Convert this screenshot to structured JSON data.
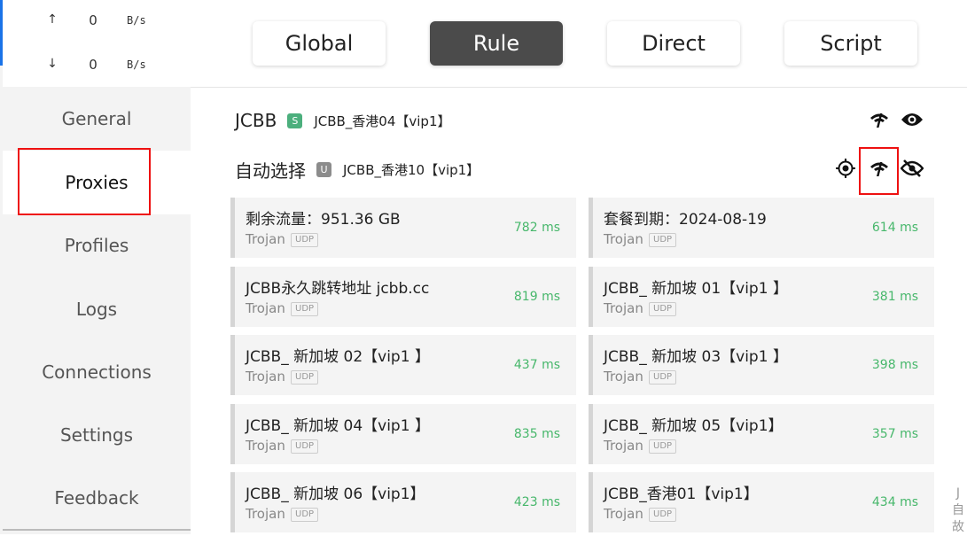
{
  "traffic": {
    "upload": {
      "arrow": "↑",
      "value": "0",
      "unit": "B/s"
    },
    "download": {
      "arrow": "↓",
      "value": "0",
      "unit": "B/s"
    }
  },
  "nav": {
    "items": [
      {
        "label": "General"
      },
      {
        "label": "Proxies"
      },
      {
        "label": "Profiles"
      },
      {
        "label": "Logs"
      },
      {
        "label": "Connections"
      },
      {
        "label": "Settings"
      },
      {
        "label": "Feedback"
      }
    ]
  },
  "modes": [
    {
      "label": "Global"
    },
    {
      "label": "Rule"
    },
    {
      "label": "Direct"
    },
    {
      "label": "Script"
    }
  ],
  "groups": [
    {
      "name": "JCBB",
      "badge": "S",
      "badge_color": "#4caf7d",
      "now": "JCBB_香港04【vip1】"
    },
    {
      "name": "自动选择",
      "badge": "U",
      "badge_color": "#8c8c8c",
      "now": "JCBB_香港10【vip1】"
    }
  ],
  "proxies": [
    {
      "name": "剩余流量：951.36 GB",
      "type": "Trojan",
      "udp": "UDP",
      "delay": "782 ms"
    },
    {
      "name": "套餐到期：2024-08-19",
      "type": "Trojan",
      "udp": "UDP",
      "delay": "614 ms"
    },
    {
      "name": "JCBB永久跳转地址 jcbb.cc",
      "type": "Trojan",
      "udp": "UDP",
      "delay": "819 ms"
    },
    {
      "name": "JCBB_ 新加坡 01【vip1 】",
      "type": "Trojan",
      "udp": "UDP",
      "delay": "381 ms"
    },
    {
      "name": "JCBB_ 新加坡 02【vip1 】",
      "type": "Trojan",
      "udp": "UDP",
      "delay": "437 ms"
    },
    {
      "name": "JCBB_ 新加坡 03【vip1 】",
      "type": "Trojan",
      "udp": "UDP",
      "delay": "398 ms"
    },
    {
      "name": "JCBB_ 新加坡 04【vip1 】",
      "type": "Trojan",
      "udp": "UDP",
      "delay": "835 ms"
    },
    {
      "name": "JCBB_ 新加坡 05【vip1】",
      "type": "Trojan",
      "udp": "UDP",
      "delay": "357 ms"
    },
    {
      "name": "JCBB_ 新加坡 06【vip1】",
      "type": "Trojan",
      "udp": "UDP",
      "delay": "423 ms"
    },
    {
      "name": "JCBB_香港01【vip1】",
      "type": "Trojan",
      "udp": "UDP",
      "delay": "434 ms"
    }
  ],
  "side_fragment": [
    "J",
    "自",
    "故"
  ],
  "colors": {
    "accent": "#1a73e8",
    "delay_good": "#47b76b",
    "highlight": "#e11111",
    "active_mode": "#4b4b4b"
  }
}
